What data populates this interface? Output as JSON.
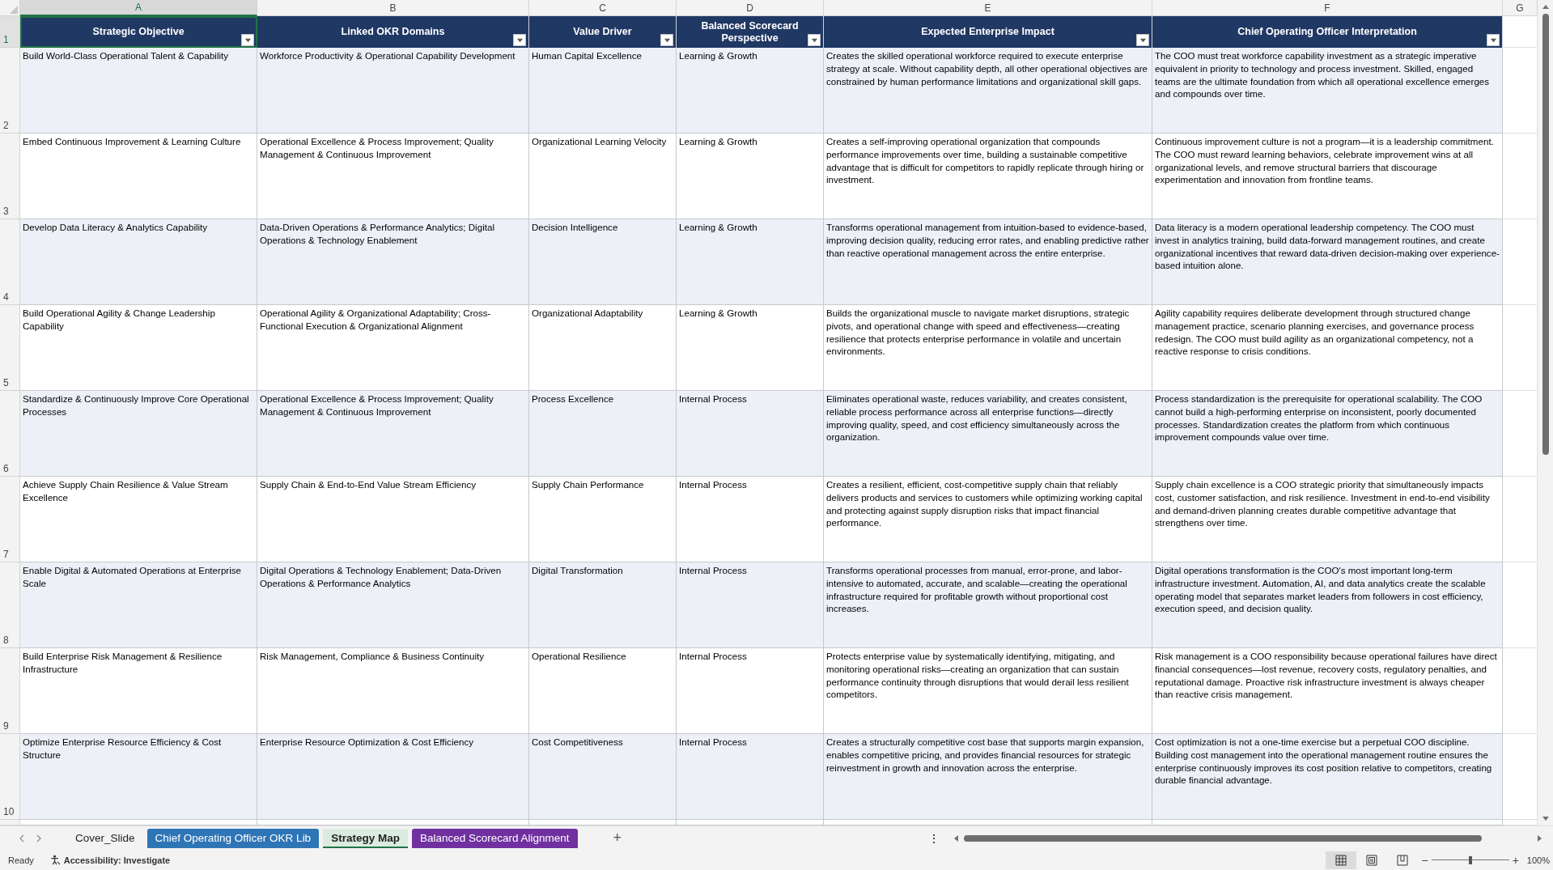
{
  "column_letters": [
    {
      "label": "A",
      "selected": true
    },
    {
      "label": "B",
      "selected": false
    },
    {
      "label": "C",
      "selected": false
    },
    {
      "label": "D",
      "selected": false
    },
    {
      "label": "E",
      "selected": false
    },
    {
      "label": "F",
      "selected": false
    },
    {
      "label": "G",
      "selected": false
    }
  ],
  "header_row": {
    "row_number": "1",
    "cells": [
      {
        "text": "Strategic Objective",
        "filter": true,
        "selected": true
      },
      {
        "text": "Linked OKR Domains",
        "filter": true,
        "selected": false
      },
      {
        "text": "Value Driver",
        "filter": true,
        "selected": false
      },
      {
        "text": "Balanced Scorecard Perspective",
        "filter": true,
        "selected": false
      },
      {
        "text": "Expected Enterprise Impact",
        "filter": true,
        "selected": false
      },
      {
        "text": "Chief Operating Officer Interpretation",
        "filter": true,
        "selected": false
      }
    ]
  },
  "rows": [
    {
      "row_number": "2",
      "cells": [
        "Build World-Class Operational Talent & Capability",
        "Workforce Productivity & Operational Capability Development",
        "Human Capital Excellence",
        "Learning & Growth",
        "Creates the skilled operational workforce required to execute enterprise strategy at scale. Without capability depth, all other operational objectives are constrained by human performance limitations and organizational skill gaps.",
        "The COO must treat workforce capability investment as a strategic imperative equivalent in priority to technology and process investment. Skilled, engaged teams are the ultimate foundation from which all operational excellence emerges and compounds over time."
      ]
    },
    {
      "row_number": "3",
      "cells": [
        "Embed Continuous Improvement & Learning Culture",
        "Operational Excellence & Process Improvement; Quality Management & Continuous Improvement",
        "Organizational Learning Velocity",
        "Learning & Growth",
        "Creates a self-improving operational organization that compounds performance improvements over time, building a sustainable competitive advantage that is difficult for competitors to rapidly replicate through hiring or investment.",
        "Continuous improvement culture is not a program—it is a leadership commitment. The COO must reward learning behaviors, celebrate improvement wins at all organizational levels, and remove structural barriers that discourage experimentation and innovation from frontline teams."
      ]
    },
    {
      "row_number": "4",
      "cells": [
        "Develop Data Literacy & Analytics Capability",
        "Data-Driven Operations & Performance Analytics; Digital Operations & Technology Enablement",
        "Decision Intelligence",
        "Learning & Growth",
        "Transforms operational management from intuition-based to evidence-based, improving decision quality, reducing error rates, and enabling predictive rather than reactive operational management across the entire enterprise.",
        "Data literacy is a modern operational leadership competency. The COO must invest in analytics training, build data-forward management routines, and create organizational incentives that reward data-driven decision-making over experience-based intuition alone."
      ]
    },
    {
      "row_number": "5",
      "cells": [
        "Build Operational Agility & Change Leadership Capability",
        "Operational Agility & Organizational Adaptability; Cross-Functional Execution & Organizational Alignment",
        "Organizational Adaptability",
        "Learning & Growth",
        "Builds the organizational muscle to navigate market disruptions, strategic pivots, and operational change with speed and effectiveness—creating resilience that protects enterprise performance in volatile and uncertain environments.",
        "Agility capability requires deliberate development through structured change management practice, scenario planning exercises, and governance process redesign. The COO must build agility as an organizational competency, not a reactive response to crisis conditions."
      ]
    },
    {
      "row_number": "6",
      "cells": [
        "Standardize & Continuously Improve Core Operational Processes",
        "Operational Excellence & Process Improvement; Quality Management & Continuous Improvement",
        "Process Excellence",
        "Internal Process",
        "Eliminates operational waste, reduces variability, and creates consistent, reliable process performance across all enterprise functions—directly improving quality, speed, and cost efficiency simultaneously across the organization.",
        "Process standardization is the prerequisite for operational scalability. The COO cannot build a high-performing enterprise on inconsistent, poorly documented processes. Standardization creates the platform from which continuous improvement compounds value over time."
      ]
    },
    {
      "row_number": "7",
      "cells": [
        "Achieve Supply Chain Resilience & Value Stream Excellence",
        "Supply Chain & End-to-End Value Stream Efficiency",
        "Supply Chain Performance",
        "Internal Process",
        "Creates a resilient, efficient, cost-competitive supply chain that reliably delivers products and services to customers while optimizing working capital and protecting against supply disruption risks that impact financial performance.",
        "Supply chain excellence is a COO strategic priority that simultaneously impacts cost, customer satisfaction, and risk resilience. Investment in end-to-end visibility and demand-driven planning creates durable competitive advantage that strengthens over time."
      ]
    },
    {
      "row_number": "8",
      "cells": [
        "Enable Digital & Automated Operations at Enterprise Scale",
        "Digital Operations & Technology Enablement; Data-Driven Operations & Performance Analytics",
        "Digital Transformation",
        "Internal Process",
        "Transforms operational processes from manual, error-prone, and labor-intensive to automated, accurate, and scalable—creating the operational infrastructure required for profitable growth without proportional cost increases.",
        "Digital operations transformation is the COO's most important long-term infrastructure investment. Automation, AI, and data analytics create the scalable operating model that separates market leaders from followers in cost efficiency, execution speed, and decision quality."
      ]
    },
    {
      "row_number": "9",
      "cells": [
        "Build Enterprise Risk Management & Resilience Infrastructure",
        "Risk Management, Compliance & Business Continuity",
        "Operational Resilience",
        "Internal Process",
        "Protects enterprise value by systematically identifying, mitigating, and monitoring operational risks—creating an organization that can sustain performance continuity through disruptions that would derail less resilient competitors.",
        "Risk management is a COO responsibility because operational failures have direct financial consequences—lost revenue, recovery costs, regulatory penalties, and reputational damage. Proactive risk infrastructure investment is always cheaper than reactive crisis management."
      ]
    },
    {
      "row_number": "10",
      "cells": [
        "Optimize Enterprise Resource Efficiency & Cost Structure",
        "Enterprise Resource Optimization & Cost Efficiency",
        "Cost Competitiveness",
        "Internal Process",
        "Creates a structurally competitive cost base that supports margin expansion, enables competitive pricing, and provides financial resources for strategic reinvestment in growth and innovation across the enterprise.",
        "Cost optimization is not a one-time exercise but a perpetual COO discipline. Building cost management into the operational management routine ensures the enterprise continuously improves its cost position relative to competitors, creating durable financial advantage."
      ]
    }
  ],
  "sheet_tabs": [
    {
      "label": "Cover_Slide",
      "selected": false
    },
    {
      "label": "Chief Operating Officer OKR Lib",
      "selected": false,
      "color": "#2e75b6"
    },
    {
      "label": "Strategy Map",
      "selected": true
    },
    {
      "label": "Balanced Scorecard Alignment",
      "selected": false,
      "color": "#7030a0"
    }
  ],
  "add_sheet": "+",
  "more_menu": "⋮",
  "status_bar": {
    "status": "Ready",
    "accessibility": "Accessibility: Investigate",
    "views": [
      {
        "kind": "normal",
        "selected": true
      },
      {
        "kind": "page_layout",
        "selected": false
      },
      {
        "kind": "page_break",
        "selected": false
      }
    ],
    "zoom_out": "−",
    "zoom_in": "+",
    "zoom": {
      "level": 0.5,
      "reading": "100%"
    }
  }
}
